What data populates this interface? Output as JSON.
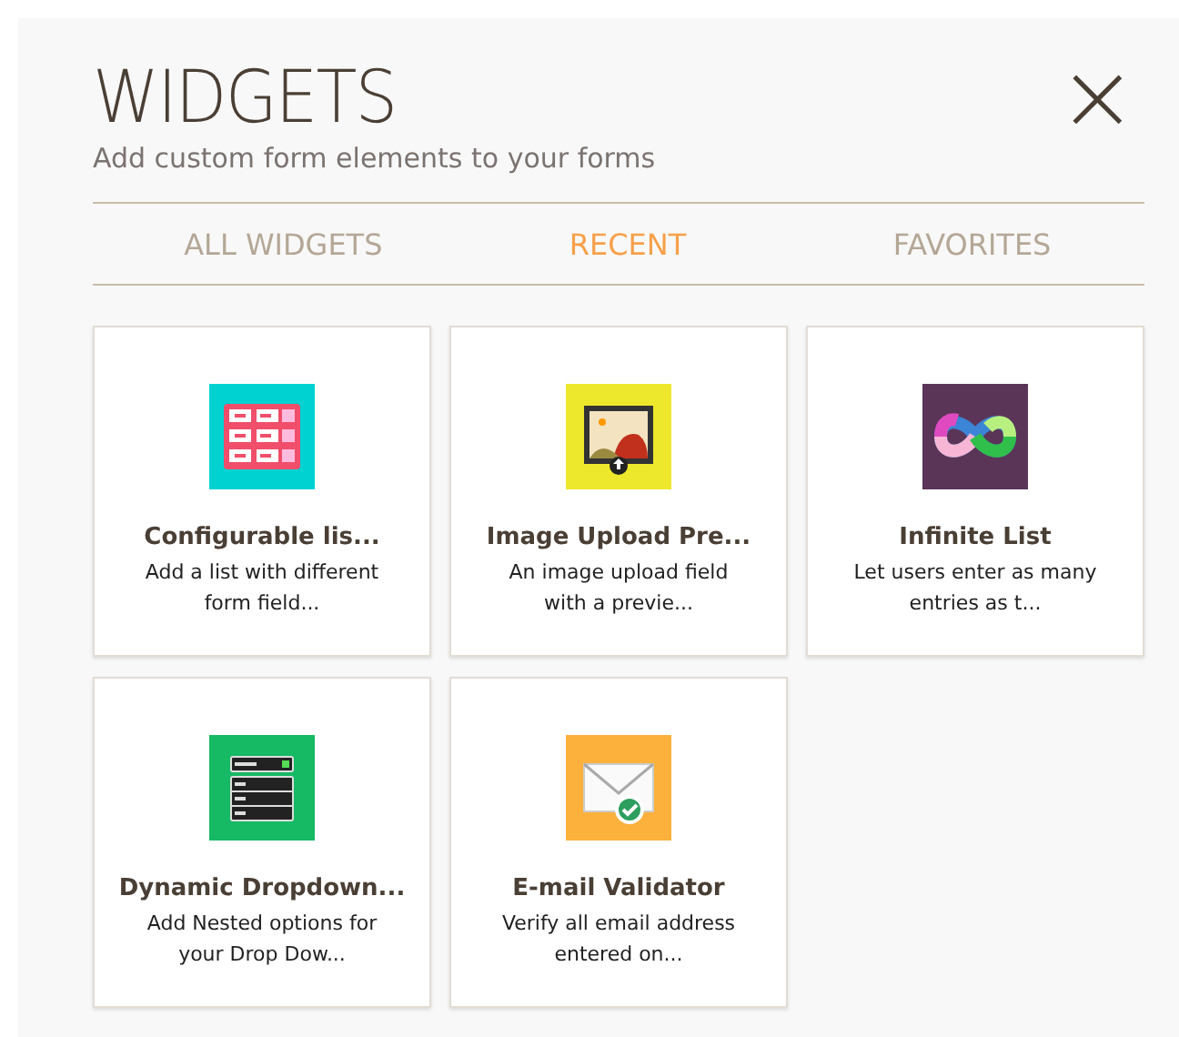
{
  "header": {
    "title": "WIDGETS",
    "subtitle": "Add custom form elements to your forms",
    "close": "×"
  },
  "tabs": [
    {
      "label": "ALL WIDGETS",
      "selected": false
    },
    {
      "label": "RECENT",
      "selected": true
    },
    {
      "label": "FAVORITES",
      "selected": false
    }
  ],
  "widgets": [
    {
      "kind": "list",
      "color": "#00d2d2",
      "title": "Configurable lis...",
      "description": "Add a list with different form field..."
    },
    {
      "kind": "image",
      "color": "#eee82c",
      "title": "Image Upload Pre...",
      "description": "An image upload field with a previe..."
    },
    {
      "kind": "infinity",
      "color": "#5a3557",
      "title": "Infinite List",
      "description": "Let users enter as many entries as t..."
    },
    {
      "kind": "dropdown",
      "color": "#16b964",
      "title": "Dynamic Dropdown...",
      "description": "Add Nested options for your Drop Dow..."
    },
    {
      "kind": "email",
      "color": "#fbb13b",
      "title": "E-mail Validator",
      "description": "Verify all email address entered on..."
    }
  ]
}
